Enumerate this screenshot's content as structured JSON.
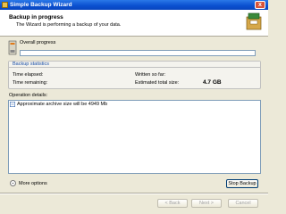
{
  "window": {
    "title": "Simple Backup Wizard",
    "close_label": "x"
  },
  "header": {
    "title": "Backup in progress",
    "subtitle": "The Wizard is performing a backup of your data."
  },
  "progress": {
    "label": "Overall progress",
    "value_fraction": 0
  },
  "statistics": {
    "heading": "Backup statistics",
    "time_elapsed_label": "Time elapsed:",
    "time_remaining_label": "Time remaining:",
    "written_label": "Written so far:",
    "estimated_label": "Estimated total size:",
    "estimated_value": "4.7 GB"
  },
  "operation": {
    "label": "Operation details:",
    "items": [
      "Approximate archive size will be 4949 Mb"
    ]
  },
  "more_options": {
    "label": "More options",
    "icon": "chevron-down-icon"
  },
  "buttons": {
    "stop": "Stop Backup",
    "back": "< Back",
    "next": "Next >",
    "cancel": "Cancel"
  },
  "colors": {
    "title_bar": "#0a4fcf",
    "accent": "#1a4fa8",
    "face": "#ece9d8"
  }
}
